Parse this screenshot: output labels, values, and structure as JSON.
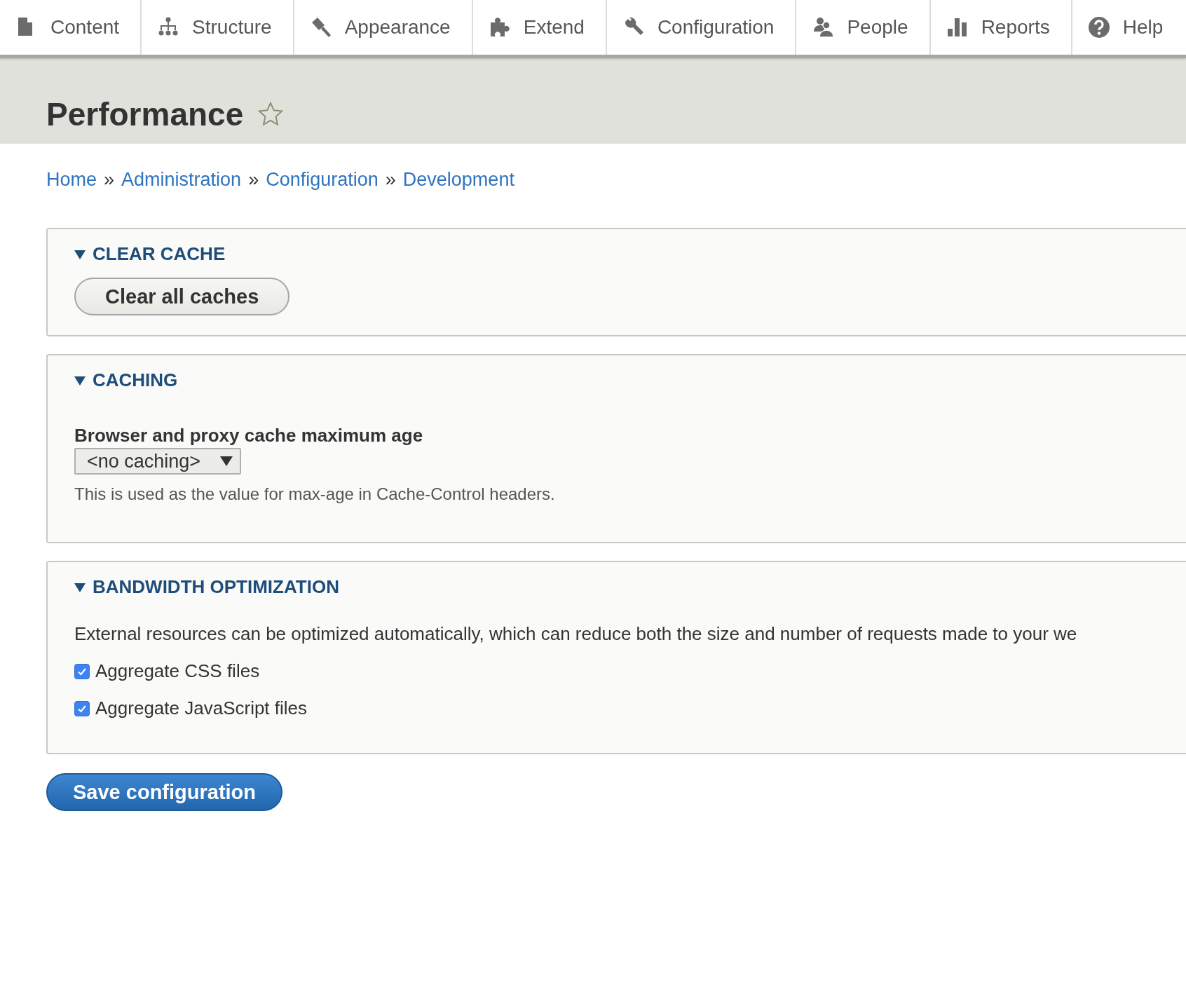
{
  "toolbar": {
    "items": [
      {
        "label": "Content",
        "kind": "page"
      },
      {
        "label": "Structure",
        "kind": "tree"
      },
      {
        "label": "Appearance",
        "kind": "brush"
      },
      {
        "label": "Extend",
        "kind": "puzzle"
      },
      {
        "label": "Configuration",
        "kind": "wrench"
      },
      {
        "label": "People",
        "kind": "people"
      },
      {
        "label": "Reports",
        "kind": "bars"
      },
      {
        "label": "Help",
        "kind": "help"
      }
    ]
  },
  "page_title": {
    "text": "Performance",
    "starred": false
  },
  "breadcrumb": {
    "separator": "»",
    "links": [
      "Home",
      "Administration",
      "Configuration",
      "Development"
    ]
  },
  "sections": [
    {
      "title": "CLEAR CACHE",
      "expanded": true,
      "kind": "button",
      "button": "Clear all caches"
    },
    {
      "title": "CACHING",
      "expanded": true,
      "kind": "select",
      "label": "Browser and proxy cache maximum age",
      "value": "<no caching>",
      "description": "This is used as the value for max-age in Cache-Control headers."
    },
    {
      "title": "BANDWIDTH OPTIMIZATION",
      "expanded": true,
      "kind": "checkboxes",
      "description": "External resources can be optimized automatically, which can reduce both the size and number of requests made to your we",
      "options": [
        {
          "label": "Aggregate CSS files",
          "checked": true
        },
        {
          "label": "Aggregate JavaScript files",
          "checked": true
        }
      ]
    }
  ],
  "save_button": "Save configuration"
}
